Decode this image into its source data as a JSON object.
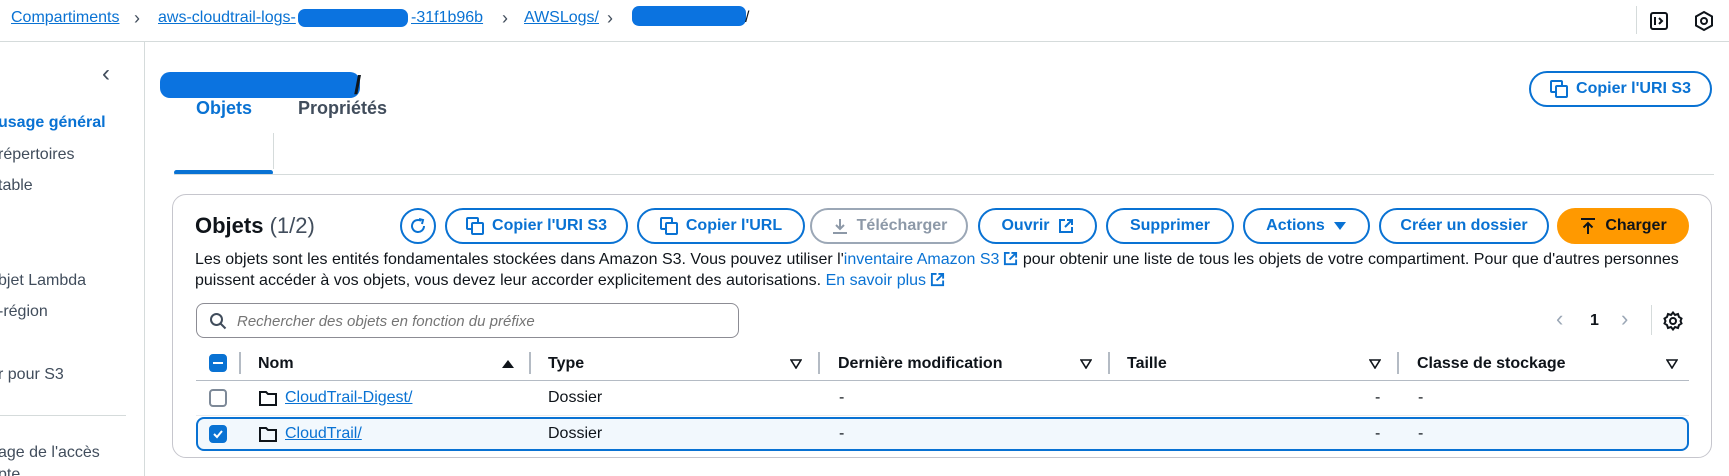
{
  "breadcrumb": {
    "items": [
      "Compartiments",
      "aws-cloudtrail-logs-",
      "-31f1b96b",
      "AWSLogs/",
      "/"
    ]
  },
  "sidebar": {
    "items": [
      {
        "label": "usage général",
        "active": true
      },
      {
        "label": "répertoires",
        "active": false
      },
      {
        "label": "table",
        "active": false
      },
      {
        "label": "bjet Lambda",
        "active": false
      },
      {
        "label": "-région",
        "active": false
      },
      {
        "label": "r pour S3",
        "active": false
      },
      {
        "label": "age de l'accès",
        "active": false
      },
      {
        "label": "pte",
        "active": false
      }
    ]
  },
  "header": {
    "title_suffix": "/",
    "copy_uri_label": "Copier l'URI S3"
  },
  "tabs": [
    {
      "label": "Objets",
      "active": true
    },
    {
      "label": "Propriétés",
      "active": false
    }
  ],
  "objects": {
    "title": "Objets",
    "count": "(1/2)",
    "buttons": {
      "copy_uri": "Copier l'URI S3",
      "copy_url": "Copier l'URL",
      "download": "Télécharger",
      "open": "Ouvrir",
      "delete": "Supprimer",
      "actions": "Actions",
      "create_folder": "Créer un dossier",
      "upload": "Charger"
    },
    "description": {
      "part1": "Les objets sont les entités fondamentales stockées dans Amazon S3. Vous pouvez utiliser l'",
      "link1": "inventaire Amazon S3",
      "part2": " pour obtenir une liste de tous les objets de votre compartiment. Pour que d'autres personnes",
      "part3": "puissent accéder à vos objets, vous devez leur accorder explicitement des autorisations. ",
      "link2": "En savoir plus"
    },
    "search_placeholder": "Rechercher des objets en fonction du préfixe",
    "page_number": "1",
    "columns": [
      "Nom",
      "Type",
      "Dernière modification",
      "Taille",
      "Classe de stockage"
    ],
    "rows": [
      {
        "name": "CloudTrail-Digest/",
        "type": "Dossier",
        "modified": "-",
        "size": "-",
        "storage_class": "-",
        "selected": false
      },
      {
        "name": "CloudTrail/",
        "type": "Dossier",
        "modified": "-",
        "size": "-",
        "storage_class": "-",
        "selected": true
      }
    ]
  },
  "colors": {
    "link": "#0972d3",
    "primary_button": "#ff9900",
    "redaction": "#0b73e0",
    "selected_row_bg": "#f2f8fd"
  }
}
